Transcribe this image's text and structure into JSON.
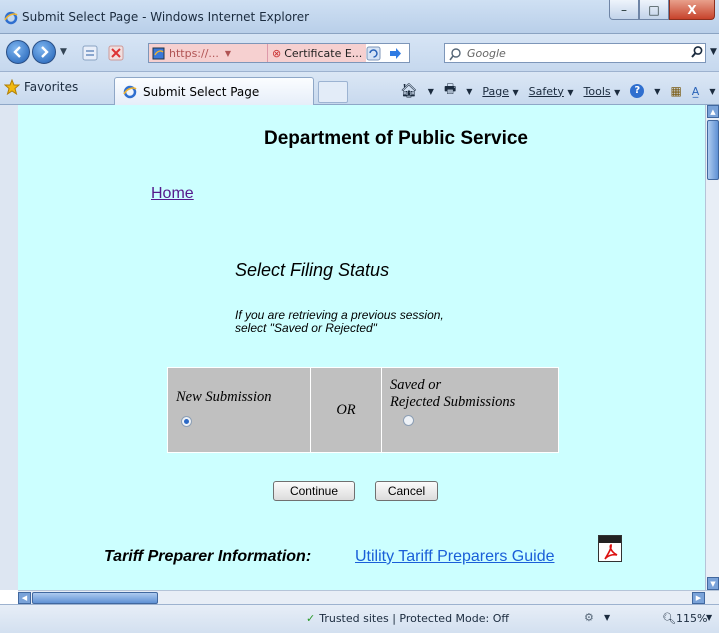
{
  "window": {
    "title": "Submit Select Page - Windows Internet Explorer",
    "buttons": {
      "minimize": "–",
      "maximize": "□",
      "close": "X"
    }
  },
  "navbar": {
    "address_url": "https://...",
    "cert_label": "Certificate E...",
    "search_placeholder": "Google"
  },
  "tabbar": {
    "favorites_label": "Favorites",
    "tab_label": "Submit Select Page",
    "commands": {
      "page": "Page",
      "safety": "Safety",
      "tools": "Tools"
    }
  },
  "page": {
    "heading": "Department of Public Service",
    "home_link": "Home",
    "select_title": "Select Filing Status",
    "note_line1": "If you are retrieving a previous session,",
    "note_line2": "select \"Saved or Rejected\"",
    "options": {
      "new_label": "New Submission",
      "or_label": "OR",
      "saved_line1": "Saved or",
      "saved_line2": "Rejected Submissions",
      "selected": "new"
    },
    "continue_label": "Continue",
    "cancel_label": "Cancel",
    "tariff_label": "Tariff Preparer Information:",
    "guide_link": "Utility Tariff Preparers Guide"
  },
  "statusbar": {
    "zone_text": "Trusted sites | Protected Mode: Off",
    "zoom_text": "115%"
  },
  "colors": {
    "page_bg": "#ccffff",
    "table_bg": "#c0c0c0",
    "link": "#1a5fd8",
    "visited": "#551a8b"
  }
}
